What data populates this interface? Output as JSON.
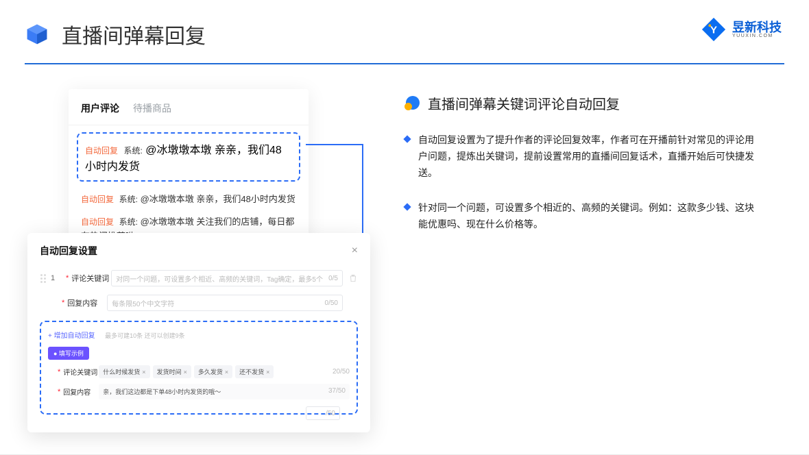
{
  "header": {
    "title": "直播间弹幕回复"
  },
  "brand": {
    "name": "昱新科技",
    "url": "YUUXIN.COM"
  },
  "commentsCard": {
    "tabs": [
      "用户评论",
      "待播商品"
    ],
    "highlight": {
      "auto": "自动回复",
      "sys": "系统:",
      "text": "@冰墩墩本墩 亲亲，我们48小时内发货"
    },
    "items": [
      {
        "auto": "自动回复",
        "sys": "系统:",
        "text": "@冰墩墩本墩 亲亲，我们48小时内发货"
      },
      {
        "auto": "自动回复",
        "sys": "系统:",
        "text": "@冰墩墩本墩 关注我们的店铺，每日都有热门推荐呦～"
      }
    ]
  },
  "settings": {
    "title": "自动回复设置",
    "idx": "1",
    "keywordLabel": "评论关键词",
    "keywordPlaceholder": "对同一个问题，可设置多个相近、高频的关键词，Tag确定，最多5个",
    "kwCounter": "0/5",
    "contentLabel": "回复内容",
    "contentPlaceholder": "每条限50个中文字符",
    "contentCounter": "0/50",
    "addLink": "+ 增加自动回复",
    "addNote": "最多可建10条 还可以创建9条",
    "pill": "● 填写示例",
    "exKeywordLabel": "评论关键词",
    "exChips": [
      "什么时候发货",
      "发货时间",
      "多久发货",
      "还不发货"
    ],
    "exKwCounter": "20/50",
    "exContentLabel": "回复内容",
    "exContent": "亲，我们这边都是下单48小时内发货的哦～",
    "exContentCounter": "37/50",
    "footerCounter": "/50"
  },
  "right": {
    "sectionTitle": "直播间弹幕关键词评论自动回复",
    "p1": "自动回复设置为了提升作者的评论回复效率，作者可在开播前针对常见的评论用户问题，提炼出关键词，提前设置常用的直播间回复话术，直播开始后可快捷发送。",
    "p2": "针对同一个问题，可设置多个相近的、高频的关键词。例如：这款多少钱、这块能优惠吗、现在什么价格等。"
  }
}
